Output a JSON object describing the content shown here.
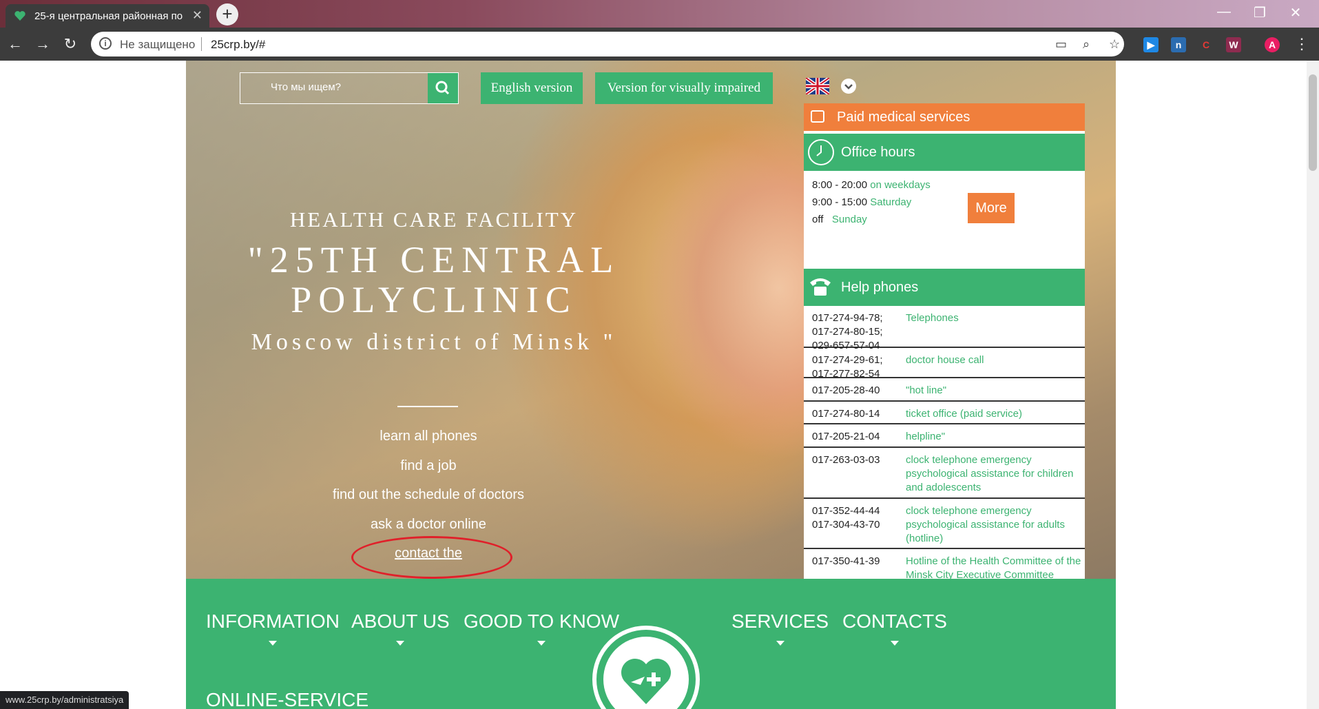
{
  "browser": {
    "tab_title": "25-я центральная районная по",
    "security_label": "Не защищено",
    "url": "25crp.by/#",
    "status_url": "www.25crp.by/administratsiya",
    "profile_initial": "A",
    "extensions": [
      "play-ext-icon",
      "blue-ext-icon",
      "c-ext-icon",
      "w-ext-icon"
    ]
  },
  "header": {
    "search_placeholder": "Что мы ищем?",
    "english_btn": "English version",
    "visually_btn": "Version for visually impaired"
  },
  "hero": {
    "subtitle": "HEALTH CARE FACILITY",
    "title": "\"25TH CENTRAL POLYCLINIC",
    "city": "Moscow district of Minsk \"",
    "links": [
      "learn all phones",
      "find a job",
      "find out the schedule of doctors",
      "ask a doctor online",
      "contact the"
    ]
  },
  "panel": {
    "paid": "Paid medical services",
    "office_title": "Office hours",
    "hours": [
      {
        "time": "8:00 - 20:00",
        "day": "on weekdays"
      },
      {
        "time": "9:00 - 15:00",
        "day": "Saturday"
      },
      {
        "time": "off",
        "day": "Sunday"
      }
    ],
    "more": "More",
    "phones_title": "Help phones",
    "phones": [
      {
        "num": "017-274-94-78;\n017-274-80-15;\n029-657-57-04",
        "desc": "Telephones"
      },
      {
        "num": "017-274-29-61;\n017-277-82-54",
        "desc": "doctor house call"
      },
      {
        "num": "017-205-28-40",
        "desc": "\"hot line\""
      },
      {
        "num": "017-274-80-14",
        "desc": "ticket office (paid service)"
      },
      {
        "num": "017-205-21-04",
        "desc": "helpline\""
      },
      {
        "num": "017-263-03-03",
        "desc": "clock telephone emergency psychological assistance for children and adolescents"
      },
      {
        "num": "017-352-44-44\n017-304-43-70",
        "desc": "clock telephone emergency psychological assistance for adults (hotline)"
      },
      {
        "num": "017-350-41-39",
        "desc": "Hotline of the Health Committee of the Minsk City Executive Committee"
      }
    ]
  },
  "nav": {
    "items": [
      "INFORMATION",
      "ABOUT US",
      "GOOD TO KNOW",
      "SERVICES",
      "CONTACTS",
      "ONLINE-SERVICE"
    ]
  },
  "colors": {
    "green": "#3cb371",
    "orange": "#f07f3c",
    "annotation_red": "#e0202a"
  }
}
